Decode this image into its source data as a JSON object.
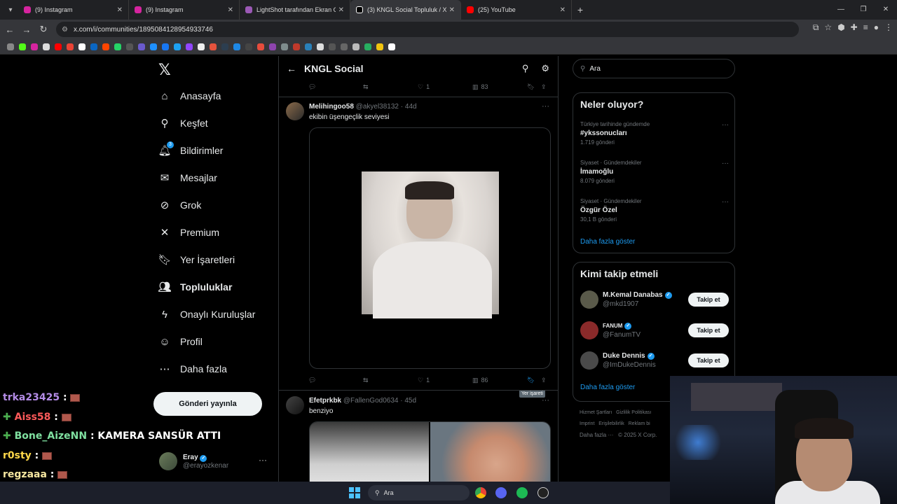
{
  "browser": {
    "tabs": [
      {
        "title": "(9) Instagram",
        "color": "#d6249f",
        "active": false
      },
      {
        "title": "(9) Instagram",
        "color": "#d6249f",
        "active": false
      },
      {
        "title": "LightShot tarafından Ekran Gör",
        "color": "#9b59b6",
        "active": false
      },
      {
        "title": "(3) KNGL Social Topluluk / X",
        "color": "#ffffff",
        "active": true
      },
      {
        "title": "(25) YouTube",
        "color": "#ff0000",
        "active": false
      }
    ],
    "url": "x.com/i/communities/1895084128954933746"
  },
  "leftnav": {
    "items": [
      {
        "label": "Anasayfa",
        "icon": "home-icon",
        "glyph": "⌂"
      },
      {
        "label": "Keşfet",
        "icon": "search-icon",
        "glyph": "⚲"
      },
      {
        "label": "Bildirimler",
        "icon": "bell-icon",
        "glyph": "🔔︎",
        "badge": "3"
      },
      {
        "label": "Mesajlar",
        "icon": "mail-icon",
        "glyph": "✉"
      },
      {
        "label": "Grok",
        "icon": "grok-icon",
        "glyph": "⊘"
      },
      {
        "label": "Premium",
        "icon": "x-premium-icon",
        "glyph": "✕"
      },
      {
        "label": "Yer İşaretleri",
        "icon": "bookmark-icon",
        "glyph": "🔖︎"
      },
      {
        "label": "Topluluklar",
        "icon": "communities-icon",
        "glyph": "👥︎"
      },
      {
        "label": "Onaylı Kuruluşlar",
        "icon": "lightning-icon",
        "glyph": "ϟ"
      },
      {
        "label": "Profil",
        "icon": "person-icon",
        "glyph": "☺"
      },
      {
        "label": "Daha fazla",
        "icon": "more-circle-icon",
        "glyph": "⋯"
      }
    ],
    "post_button": "Gönderi yayınla",
    "profile": {
      "name": "Eray",
      "handle": "@erayozkenar"
    }
  },
  "feed": {
    "title": "KNGL Social",
    "top_actions": {
      "likes": "1",
      "views": "83"
    },
    "tweet1": {
      "name": "Melihingoo58",
      "handle": "@akyel38132",
      "time": "· 44d",
      "text": "ekibin üşengeçlik seviyesi",
      "likes": "1",
      "views": "86"
    },
    "tooltip": "Yer işareti",
    "tweet2": {
      "name": "Efetprkbk",
      "handle": "@FallenGod0634",
      "time": "· 45d",
      "text": "benziyo"
    }
  },
  "right": {
    "search_placeholder": "Ara",
    "trends_title": "Neler oluyor?",
    "trends": [
      {
        "context": "Türkiye tarihinde gündemde",
        "name": "#ykssonucları",
        "count": "1.719 gönderi"
      },
      {
        "context": "Siyaset · Gündemdekiler",
        "name": "İmamoğlu",
        "count": "8.079 gönderi"
      },
      {
        "context": "Siyaset · Gündemdekiler",
        "name": "Özgür Özel",
        "count": "30,1 B gönderi"
      }
    ],
    "trends_more": "Daha fazla göster",
    "wtf_title": "Kimi takip etmeli",
    "wtf": [
      {
        "name": "M.Kemal Danabas",
        "handle": "@mkd1907",
        "button": "Takip et",
        "color": "#5a5a4a"
      },
      {
        "name": "FANUM",
        "handle": "@FanumTV",
        "button": "Takip et",
        "color": "#8a2a2a"
      },
      {
        "name": "Duke Dennis",
        "handle": "@ImDukeDennis",
        "button": "Takip et",
        "color": "#4a4a4a"
      }
    ],
    "wtf_more": "Daha fazla göster",
    "footer1": "Hizmet Şartları   Gizlilik Politikası",
    "footer2": "Imprint   Erişilebilirlik   Reklam bi",
    "footer3": "Daha fazla ···   © 2025 X Corp."
  },
  "chat": [
    {
      "user": "trka23425",
      "color": "#b48ce6",
      "msg": ":",
      "brick": true,
      "clover": false
    },
    {
      "user": "Aiss58",
      "color": "#ff5a5a",
      "msg": ":",
      "brick": true,
      "clover": true
    },
    {
      "user": "Bone_AizeNN",
      "color": "#7fe0a0",
      "msg": ": KAMERA SANSÜR ATTI",
      "brick": false,
      "clover": true
    },
    {
      "user": "r0sty",
      "color": "#ffd84a",
      "msg": ":",
      "brick": true,
      "clover": false
    },
    {
      "user": "regzaaa",
      "color": "#f5e6a0",
      "msg": ":",
      "brick": true,
      "clover": false
    }
  ],
  "taskbar": {
    "search": "Ara"
  }
}
